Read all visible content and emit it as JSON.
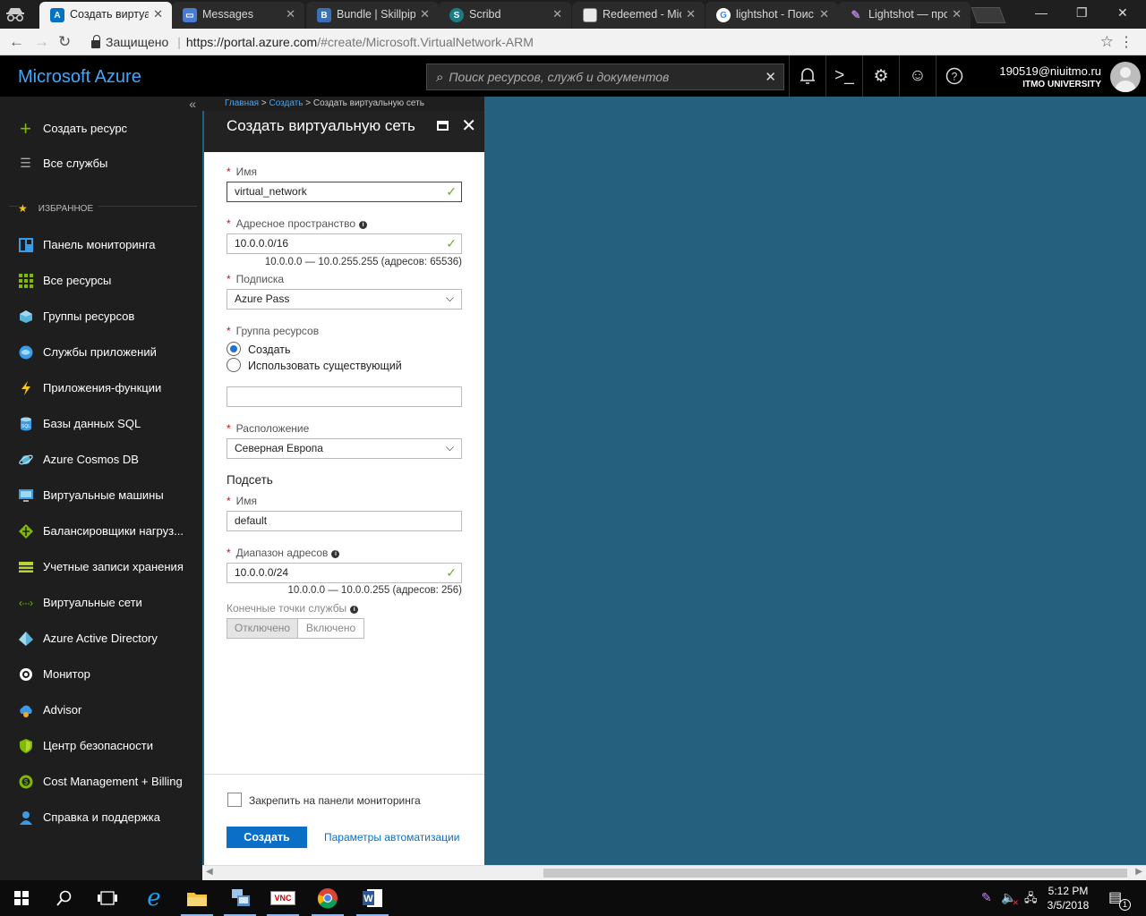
{
  "browser": {
    "tabs": [
      {
        "title": "Создать виртуал",
        "favicon": "azure-icon",
        "color": "#0072c6",
        "glyph": "A",
        "active": true
      },
      {
        "title": "Messages",
        "favicon": "messages-icon",
        "color": "#4a7bd0",
        "glyph": "▭",
        "active": false
      },
      {
        "title": "Bundle | Skillpipe",
        "favicon": "skillpipe-icon",
        "color": "#3b6fb6",
        "glyph": "B",
        "active": false
      },
      {
        "title": "Scribd",
        "favicon": "scribd-icon",
        "color": "#1e7b85",
        "glyph": "S",
        "active": false
      },
      {
        "title": "Redeemed - Mic",
        "favicon": "document-icon",
        "color": "#eaeaea",
        "glyph": "",
        "active": false
      },
      {
        "title": "lightshot - Поис",
        "favicon": "google-icon",
        "color": "#ffffff",
        "glyph": "G",
        "active": false
      },
      {
        "title": "Lightshot — про",
        "favicon": "feather-icon",
        "color": "#9b59c9",
        "glyph": "✎",
        "active": false
      }
    ],
    "secure_label": "Защищено",
    "url_host": "https://portal.azure.com",
    "url_rest": "/#create/Microsoft.VirtualNetwork-ARM"
  },
  "azure": {
    "brand": "Microsoft Azure",
    "search_placeholder": "Поиск ресурсов, служб и документов",
    "account_email": "190519@niuitmo.ru",
    "account_org": "ITMO UNIVERSITY"
  },
  "sidebar": {
    "create": "Создать ресурс",
    "all_services": "Все службы",
    "favorites_heading": "ИЗБРАННОЕ",
    "items": [
      {
        "label": "Панель мониторинга",
        "icon": "dashboard-icon",
        "color": "#3a9be8"
      },
      {
        "label": "Все ресурсы",
        "icon": "all-resources-icon",
        "color": "#7fba00"
      },
      {
        "label": "Группы ресурсов",
        "icon": "resource-groups-icon",
        "color": "#59b4d9"
      },
      {
        "label": "Службы приложений",
        "icon": "app-services-icon",
        "color": "#3a9be8"
      },
      {
        "label": "Приложения-функции",
        "icon": "function-apps-icon",
        "color": "#f5c518"
      },
      {
        "label": "Базы данных SQL",
        "icon": "sql-database-icon",
        "color": "#3a9be8"
      },
      {
        "label": "Azure Cosmos DB",
        "icon": "cosmos-db-icon",
        "color": "#59b4d9"
      },
      {
        "label": "Виртуальные машины",
        "icon": "virtual-machines-icon",
        "color": "#3a9be8"
      },
      {
        "label": "Балансировщики нагруз...",
        "icon": "load-balancer-icon",
        "color": "#7fba00"
      },
      {
        "label": "Учетные записи хранения",
        "icon": "storage-accounts-icon",
        "color": "#b8d432"
      },
      {
        "label": "Виртуальные сети",
        "icon": "virtual-networks-icon",
        "color": "#7fba00"
      },
      {
        "label": "Azure Active Directory",
        "icon": "active-directory-icon",
        "color": "#59b4d9"
      },
      {
        "label": "Монитор",
        "icon": "monitor-icon",
        "color": "#ffffff"
      },
      {
        "label": "Advisor",
        "icon": "advisor-icon",
        "color": "#3a9be8"
      },
      {
        "label": "Центр безопасности",
        "icon": "security-center-icon",
        "color": "#7fba00"
      },
      {
        "label": "Cost Management + Billing",
        "icon": "cost-management-icon",
        "color": "#7fba00"
      },
      {
        "label": "Справка и поддержка",
        "icon": "help-support-icon",
        "color": "#3a9be8"
      }
    ]
  },
  "breadcrumb": {
    "home": "Главная",
    "create": "Создать",
    "current": "Создать виртуальную сеть"
  },
  "blade": {
    "title": "Создать виртуальную сеть",
    "name_label": "Имя",
    "name_value": "virtual_network",
    "address_space_label": "Адресное пространство",
    "address_space_value": "10.0.0.0/16",
    "address_space_hint": "10.0.0.0 — 10.0.255.255 (адресов: 65536)",
    "subscription_label": "Подписка",
    "subscription_value": "Azure Pass",
    "resource_group_label": "Группа ресурсов",
    "rg_option_create": "Создать",
    "rg_option_existing": "Использовать существующий",
    "rg_name_value": "",
    "location_label": "Расположение",
    "location_value": "Северная Европа",
    "subnet_heading": "Подсеть",
    "subnet_name_label": "Имя",
    "subnet_name_value": "default",
    "subnet_range_label": "Диапазон адресов",
    "subnet_range_value": "10.0.0.0/24",
    "subnet_range_hint": "10.0.0.0 — 10.0.0.255 (адресов: 256)",
    "service_endpoints_label": "Конечные точки службы",
    "toggle_off": "Отключено",
    "toggle_on": "Включено",
    "pin_label": "Закрепить на панели мониторинга",
    "create_button": "Создать",
    "automation_link": "Параметры автоматизации"
  },
  "taskbar": {
    "time": "5:12 PM",
    "date": "3/5/2018",
    "notifications": "1"
  }
}
